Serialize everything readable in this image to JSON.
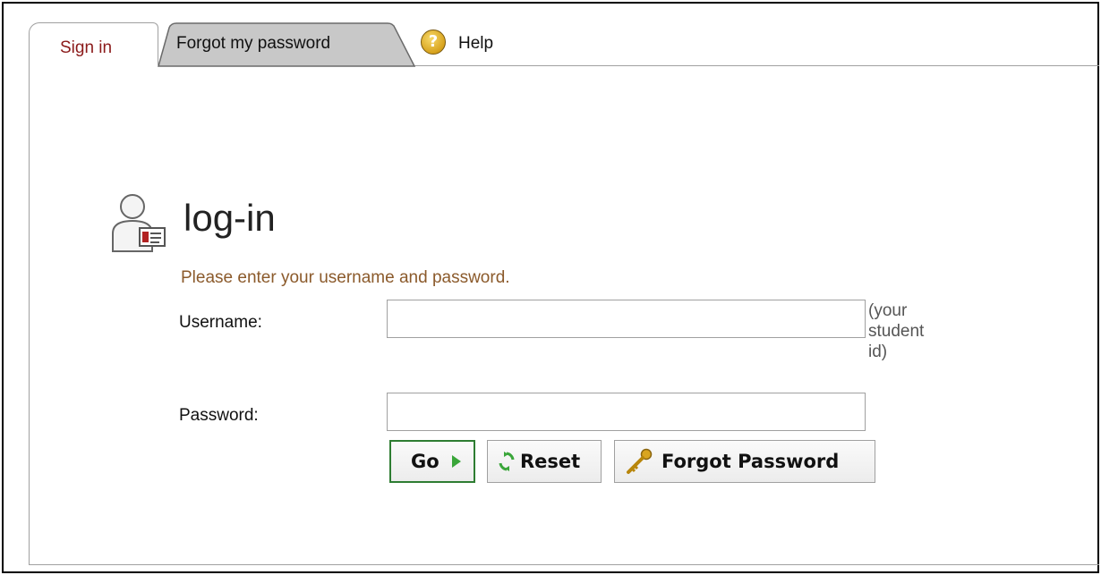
{
  "tabs": {
    "sign_in": "Sign in",
    "forgot_password": "Forgot my password",
    "help": "Help"
  },
  "login": {
    "title": "log-in",
    "instructions": "Please enter your username and password.",
    "username_label": "Username:",
    "username_value": "",
    "username_hint_lines": [
      "(your",
      "student",
      "id)"
    ],
    "password_label": "Password:",
    "password_value": ""
  },
  "buttons": {
    "go": "Go",
    "reset": "Reset",
    "forgot": "Forgot Password"
  },
  "colors": {
    "active_tab_text": "#8b1a1a",
    "instruction_text": "#8b5a2b",
    "go_border": "#2e7d32"
  },
  "icons": {
    "help": "help-question-icon",
    "login": "user-id-card-icon",
    "go": "play-arrow-icon",
    "reset": "refresh-arrows-icon",
    "forgot": "key-icon"
  }
}
